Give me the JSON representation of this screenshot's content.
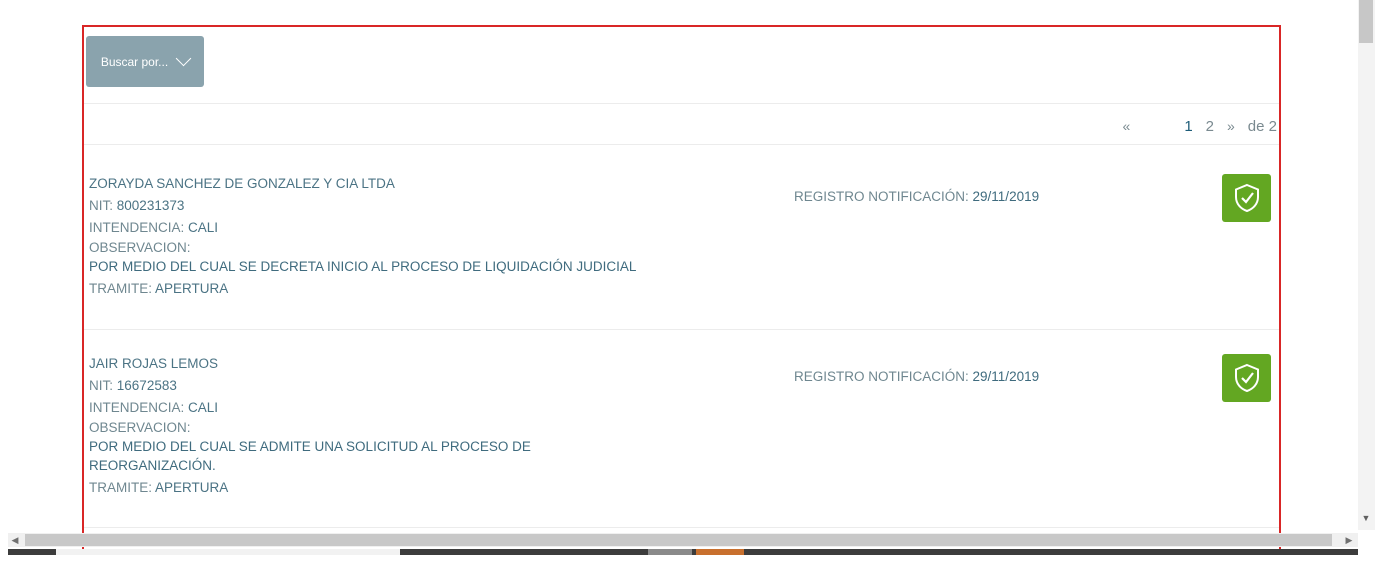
{
  "search": {
    "label": "Buscar por..."
  },
  "pagination": {
    "prev": "«",
    "pages": [
      "1",
      "2"
    ],
    "current": "1",
    "next": "»",
    "total": "de 2"
  },
  "labels": {
    "nit": "NIT:",
    "intendencia": "INTENDENCIA:",
    "observacion": "OBSERVACION:",
    "tramite": "TRAMITE:",
    "registro": "REGISTRO NOTIFICACIÓN:"
  },
  "records": [
    {
      "name": "ZORAYDA SANCHEZ DE GONZALEZ Y CIA LTDA",
      "nit": "800231373",
      "intendencia": "CALI",
      "observacion": "POR MEDIO DEL CUAL SE DECRETA INICIO AL PROCESO DE LIQUIDACIÓN JUDICIAL",
      "tramite": "APERTURA",
      "registro": "29/11/2019"
    },
    {
      "name": "JAIR ROJAS LEMOS",
      "nit": "16672583",
      "intendencia": "CALI",
      "observacion": "POR MEDIO DEL CUAL SE ADMITE UNA SOLICITUD AL PROCESO DE REORGANIZACIÓN.",
      "tramite": "APERTURA",
      "registro": "29/11/2019"
    }
  ],
  "colors": {
    "accent_green": "#63a722",
    "button_gray": "#8aa3ad",
    "text_blue": "#3f6b7e",
    "border_red": "#d92626"
  },
  "icons": {
    "search_toggle": "chevron-down-icon",
    "badge": "shield-check-icon"
  }
}
